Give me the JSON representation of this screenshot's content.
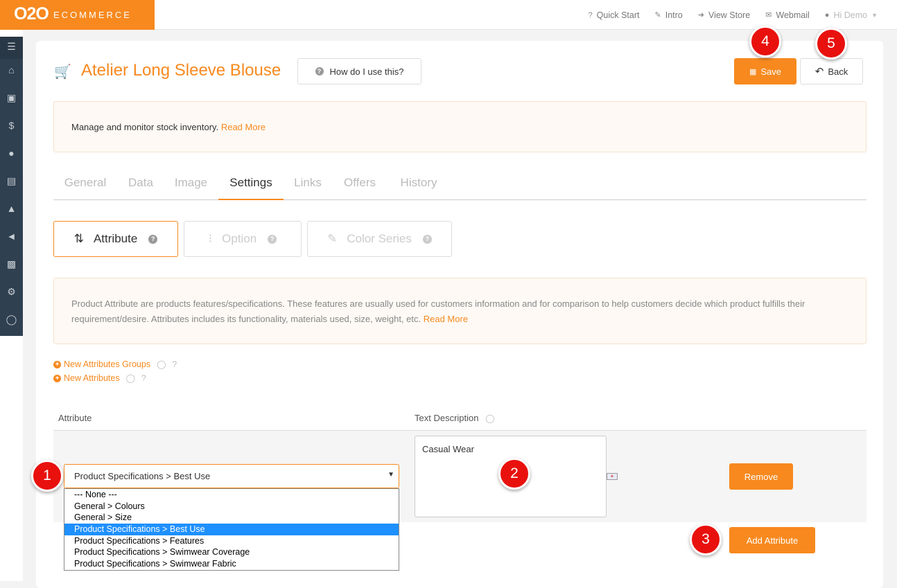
{
  "brand": {
    "logo_main": "O2O",
    "logo_sub": "ECOMMERCE"
  },
  "topnav": [
    {
      "icon": "question-icon",
      "glyph": "?",
      "label": "Quick Start"
    },
    {
      "icon": "magic-wand-icon",
      "glyph": "✎",
      "label": "Intro"
    },
    {
      "icon": "sign-in-icon",
      "glyph": "➜",
      "label": "View Store"
    },
    {
      "icon": "envelope-icon",
      "glyph": "✉",
      "label": "Webmail"
    }
  ],
  "user": {
    "label": "Hi Demo"
  },
  "page": {
    "title": "Atelier Long Sleeve Blouse",
    "help_button": "How do I use this?",
    "save_button": "Save",
    "back_button": "Back"
  },
  "info_top": {
    "text": "Manage and monitor stock inventory.",
    "link": "Read More"
  },
  "tabs": [
    {
      "label": "General",
      "active": false
    },
    {
      "label": "Data",
      "active": false
    },
    {
      "label": "Image",
      "active": false
    },
    {
      "label": "Settings",
      "active": true
    },
    {
      "label": "Links",
      "active": false
    },
    {
      "label": "Offers",
      "active": false
    },
    {
      "label": "History",
      "active": false
    }
  ],
  "subtabs": [
    {
      "label": "Attribute",
      "active": true
    },
    {
      "label": "Option",
      "active": false
    },
    {
      "label": "Color Series",
      "active": false
    }
  ],
  "info_attr": {
    "text": "Product Attribute are products features/specifications. These features are usually used for customers information and for comparison to help customers decide which product fulfills their requirement/desire. Attributes includes its functionality, materials used, size, weight, etc.",
    "link": "Read More"
  },
  "links": {
    "new_groups": "New Attributes Groups",
    "new_attributes": "New Attributes"
  },
  "table": {
    "col_attribute": "Attribute",
    "col_text": "Text Description",
    "selected": "Product Specifications > Best Use",
    "description": "Casual Wear",
    "remove_button": "Remove",
    "add_button": "Add Attribute"
  },
  "dropdown_options": [
    "--- None ---",
    "General > Colours",
    "General > Size",
    "Product Specifications > Best Use",
    "Product Specifications > Features",
    "Product Specifications > Swimwear Coverage",
    "Product Specifications > Swimwear Fabric"
  ],
  "dropdown_selected_index": 3,
  "badges": [
    "1",
    "2",
    "3",
    "4",
    "5"
  ],
  "colors": {
    "accent": "#f7891f",
    "badge": "#e8110e",
    "sidebar": "#2f4050",
    "selection": "#1e90ff"
  }
}
